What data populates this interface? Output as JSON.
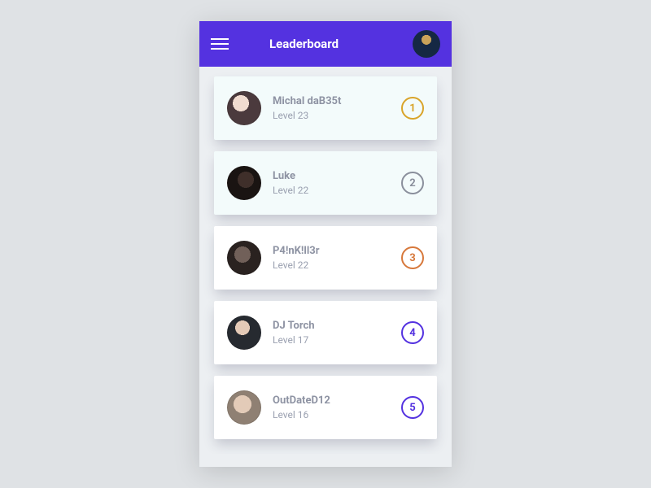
{
  "header": {
    "title": "Leaderboard"
  },
  "rank_colors": {
    "gold": "#d9a42a",
    "silver": "#8a8f9c",
    "bronze": "#d7783b",
    "accent": "#5432e0"
  },
  "players": [
    {
      "name": "Michal daB35t",
      "level_label": "Level 23",
      "rank": "1",
      "rank_color": "gold",
      "tint": true,
      "avatar_class": "av1"
    },
    {
      "name": "Luke",
      "level_label": "Level 22",
      "rank": "2",
      "rank_color": "silver",
      "tint": true,
      "avatar_class": "av2"
    },
    {
      "name": "P4!nK!ll3r",
      "level_label": "Level 22",
      "rank": "3",
      "rank_color": "bronze",
      "tint": false,
      "avatar_class": "av3"
    },
    {
      "name": "DJ Torch",
      "level_label": "Level 17",
      "rank": "4",
      "rank_color": "accent",
      "tint": false,
      "avatar_class": "av4"
    },
    {
      "name": "OutDateD12",
      "level_label": "Level 16",
      "rank": "5",
      "rank_color": "accent",
      "tint": false,
      "avatar_class": "av5"
    }
  ]
}
